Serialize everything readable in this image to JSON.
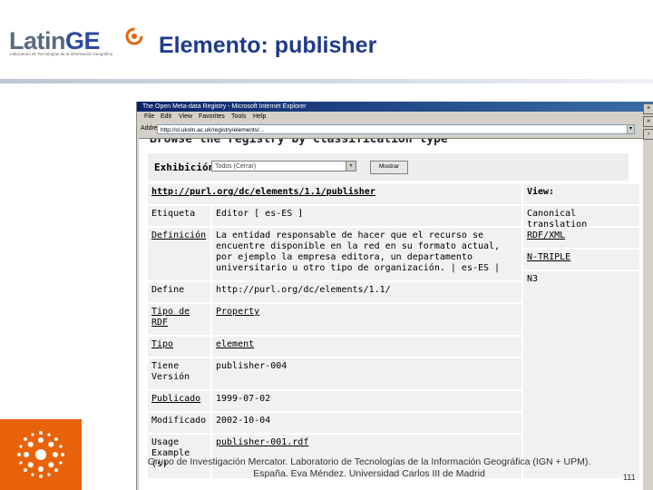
{
  "logo": {
    "name_a": "Latin",
    "name_b": "GE",
    "tagline": "Laboratorio de Tecnologías de la Información Geográfica"
  },
  "slide": {
    "title": "Elemento: publisher",
    "page_number": "111",
    "footer_line1": "Grupo de Investigación Mercator. Laboratorio de Tecnologías de la Información Geográfica (IGN + UPM).",
    "footer_line2": "España. Eva Méndez. Universidad Carlos III de Madrid"
  },
  "browser": {
    "window_title": "The Open Meta-data Registry - Microsoft Internet Explorer",
    "menu": [
      "File",
      "Edit",
      "View",
      "Favorites",
      "Tools",
      "Help"
    ],
    "address_label": "Address",
    "address_value": "http://sl.ukoln.ac.uk/registry/elements/..."
  },
  "registry": {
    "browse_heading": "Browse the registry by classification type",
    "filter_label": "Exhibición:",
    "filter_selected": "Todos (Cerrar)",
    "filter_button": "Mostrar",
    "element_uri": "http://purl.org/dc/elements/1.1/publisher",
    "rows": [
      {
        "label": "Etiqueta",
        "label_link": false,
        "value": "Editor [ es-ES ]",
        "value_link": false
      },
      {
        "label": "Definición",
        "label_link": true,
        "value": "La entidad responsable de hacer que el recurso se encuentre disponible en la red en su formato actual, por ejemplo la empresa editora, un departamento universitario u otro tipo de organización.  |  es-ES  |",
        "value_link": false
      },
      {
        "label": "Define",
        "label_link": false,
        "value": "http://purl.org/dc/elements/1.1/",
        "value_link": false
      },
      {
        "label": "Tipo de RDF",
        "label_link": true,
        "value": "Property",
        "value_link": true
      },
      {
        "label": "Tipo",
        "label_link": true,
        "value": "element",
        "value_link": true
      },
      {
        "label": "Tiene Versión",
        "label_link": false,
        "value": "publisher-004",
        "value_link": false
      },
      {
        "label": "Publicado",
        "label_link": true,
        "value": "1999-07-02",
        "value_link": false
      },
      {
        "label": "Modificado",
        "label_link": false,
        "value": "2002-10-04",
        "value_link": false
      },
      {
        "label": "Usage Example (s)",
        "label_link": false,
        "value": "publisher-001.rdf",
        "value_link": true
      }
    ],
    "view": {
      "header": "View:",
      "options": [
        "Canonical translation",
        "RDF/XML",
        "N-TRIPLE",
        "N3"
      ]
    }
  }
}
